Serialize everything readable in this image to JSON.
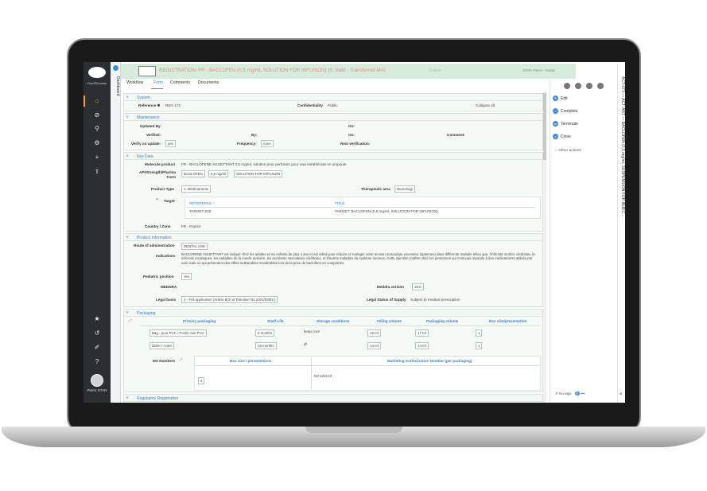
{
  "app": {
    "brand": "Doc4Process"
  },
  "rail": {
    "icons": [
      "home-icon",
      "ban-icon",
      "search-icon",
      "gear-icon",
      "plus-icon",
      "upload-icon"
    ],
    "bottom_icons": [
      "star-icon",
      "history-icon",
      "tools-icon",
      "help-icon"
    ],
    "user_name": "Pierre STAN"
  },
  "side_label": "Dashboard",
  "header": {
    "title": "REGISTRATION: FR - BACLOFEN (0,5 mg/ml, SOLUTION FOR INFUSION) (5. Valid - Transferred MA)",
    "follow": "Follow",
    "owner": "STAN Pierre - Public"
  },
  "tabs": [
    "Workflow",
    "Form",
    "Comments",
    "Documents"
  ],
  "system": {
    "title": "System",
    "reference_label": "Reference ✱",
    "reference_value": "REG-171",
    "confidentiality_label": "Confidentiality",
    "confidentiality_value": "Public",
    "collapse": "Collapse all"
  },
  "maintenance": {
    "title": "Maintenance",
    "updated_by": "Updated By:",
    "on1": "On:",
    "verified": "Verified:",
    "by": "By:",
    "on2": "On:",
    "comment": "Comment:",
    "verify_on_update": "Verify on update:",
    "verify_value": "yes",
    "frequency": "Frequency:",
    "frequency_value": "none",
    "next_verification": "Next verification:"
  },
  "key_data": {
    "title": "Key Data",
    "molecule_label": "Molecule product",
    "molecule_value": "FR - BACLOFENE AGUETTANT 0,5 mg/ml, solution pour perfusion pour voie intrathécale en ampoule",
    "api_label": "API/Strength/Pharma Form",
    "api_values": [
      "BACLOFEN",
      "0,5 mg/ml",
      "SOLUTION FOR INFUSION"
    ],
    "product_type_label": "Product Type",
    "product_type_value": "1. Medicaments",
    "therapeutic_label": "Therapeutic area",
    "therapeutic_value": "Neurology",
    "target_label": "Target",
    "target_headers": [
      "REFERENCE ↑",
      "TITLE"
    ],
    "target_rows": [
      [
        "TARGET-049",
        "TARGET: BACLOFEN (0,5 mg/ml, SOLUTION FOR INFUSION)"
      ]
    ],
    "country_label": "Country / Zone",
    "country_value": "FR - France"
  },
  "product_information": {
    "title": "Product Information",
    "route_label": "Route of administration",
    "route_value": "DENTAL USE",
    "indications_label": "Indications",
    "indications_value": "BACLOFENE AGUETTANT est indiqué chez les adultes et les enfants de plus 4 ans et est utilisé pour réduire et soulager votre tension musculaire excessive (spasmes) dans différente maladie telles que, l'infirmité motrice cérébrale, la sclérose en plaques, les maladies de la moelle épinière, les accidents vasculaires cérébraux, et d'autres maladies du système nerveux. Cette injection s'utilise chez les personnes qui n'ont pas répondu à des médicaments utilisés par voie orale ou qui présentent des effets indésirables insolérables lors de la prise de baclofène en comprimés.",
    "pediatric_label": "Pediatric position",
    "pediatric_value": "Yes",
    "meddra_label": "MEDDRA",
    "meddra_version_label": "Meddra version",
    "meddra_version_value": "16.0",
    "legal_basis_label": "Legal basis",
    "legal_basis_value": "1 - Full application (Article 8(3) of Directive No 2001/83/EC)",
    "legal_status_label": "Legal Status of Supply",
    "legal_status_value": "Subject to medical prescription"
  },
  "packaging": {
    "title": "Packaging",
    "headers": [
      "Primary packaging",
      "Shelf Life",
      "Storage conditions",
      "Filling volume",
      "Packaging volume",
      "Box size/presentation"
    ],
    "rows": [
      [
        "Bag - pour PVC / Poche non PVC",
        "3 months",
        "keep cool",
        "16 ml",
        "17 ml",
        "1"
      ],
      [
        "Other / Autre",
        "18 months",
        "df",
        "14 ml",
        "14 ml",
        "1"
      ]
    ],
    "ma_label": "MA Numbers",
    "ma_headers": [
      "Box size / presentations",
      "Marketing Authorization Number (per packaging)"
    ],
    "ma_rows": [
      [
        "2",
        "MA123123"
      ]
    ]
  },
  "regulatory": {
    "title": "Regulatory Registration"
  },
  "right_panel": {
    "actions": [
      "Edit",
      "Complete",
      "Terminate",
      "Close"
    ],
    "more": "Other actions",
    "tags": "No tags",
    "tags_count": "0"
  },
  "vertical_title": "ACT-073 — ACT: ART — BACLOFEN (0,5 mg/ml, SUSPENSION FOR INJEC..."
}
